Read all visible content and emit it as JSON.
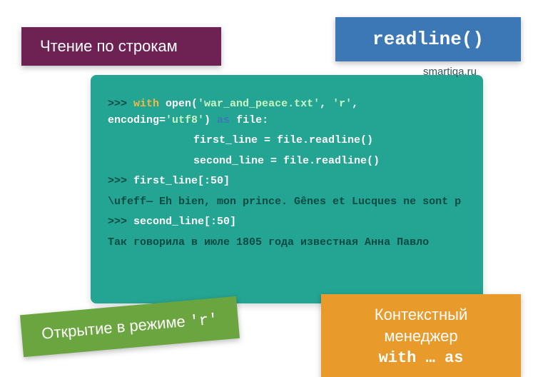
{
  "labels": {
    "purple": "Чтение по строкам",
    "blue": "readline()",
    "green_pre": "Открытие в режиме ",
    "green_code": "'r'",
    "orange_line1": "Контекстный",
    "orange_line2": "менеджер",
    "orange_code": "with … as"
  },
  "site_url": "smartiqa.ru",
  "code": {
    "prompt": ">>> ",
    "kw_with": "with",
    "fn_open": " open(",
    "arg1": "'war_and_peace.txt'",
    "comma1": ", ",
    "arg2": "'r'",
    "comma2": ", ",
    "kwarg_enc": "encoding=",
    "arg3": "'utf8'",
    "close_paren": ") ",
    "kw_as": "as",
    "asname": " file:",
    "body1": "first_line = file.readline()",
    "body2": "second_line = file.readline()",
    "expr1": "first_line[:50]",
    "out1": "\\ufeff— Eh bien, mon prince. Gênes et Lucques ne sont p",
    "expr2": "second_line[:50]",
    "out2": "Так говорила в июле 1805 года известная Анна Павло"
  }
}
